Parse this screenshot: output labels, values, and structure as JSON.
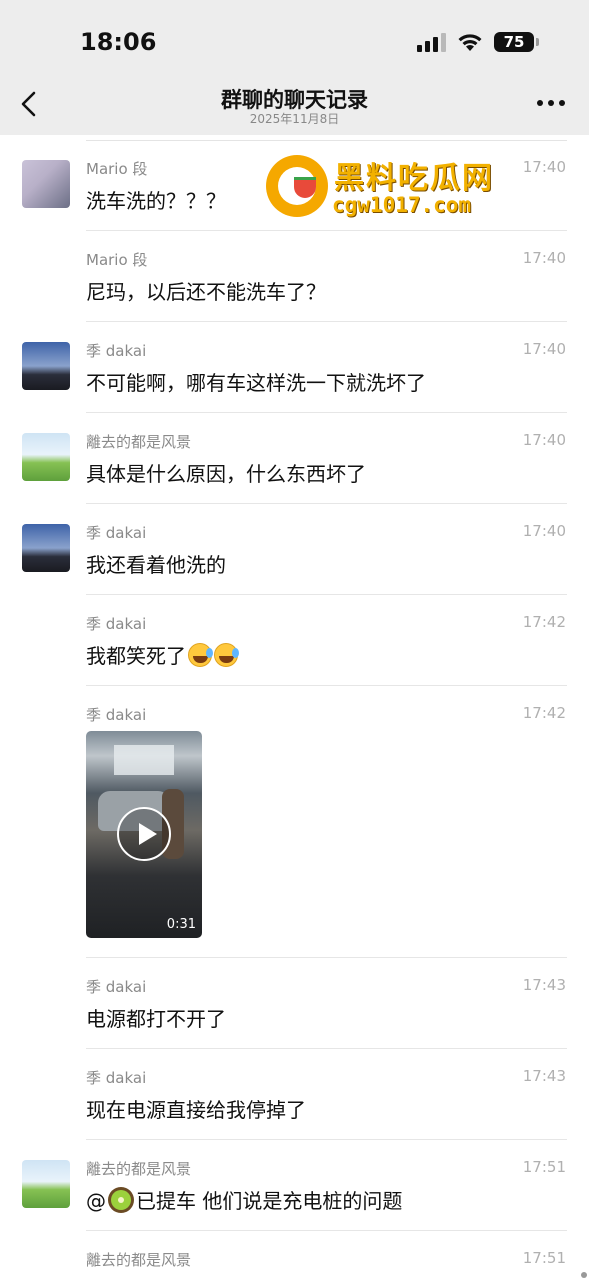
{
  "status_bar": {
    "time": "18:06",
    "battery": "75"
  },
  "nav": {
    "title": "群聊的聊天记录",
    "date": "2025年11月8日"
  },
  "watermark": {
    "title": "黑料吃瓜网",
    "url": "cgw1017.com"
  },
  "messages": [
    {
      "sender": "Mario 段",
      "time": "17:40",
      "text": "洗车洗的？？？",
      "avatar": "cat-photo"
    },
    {
      "sender": "Mario 段",
      "time": "17:40",
      "text": "尼玛，以后还不能洗车了？"
    },
    {
      "sender": "季 dakai",
      "time": "17:40",
      "text": "不可能啊，哪有车这样洗一下就洗坏了",
      "avatar": "dusk-lake"
    },
    {
      "sender": "離去的都是风景",
      "time": "17:40",
      "text": "具体是什么原因，什么东西坏了",
      "avatar": "group-on-grass"
    },
    {
      "sender": "季 dakai",
      "time": "17:40",
      "text": "我还看着他洗的",
      "avatar": "dusk-lake"
    },
    {
      "sender": "季 dakai",
      "time": "17:42",
      "text": "我都笑死了",
      "emoji": "laughing-crying-emoji"
    },
    {
      "sender": "季 dakai",
      "time": "17:42",
      "video_duration": "0:31"
    },
    {
      "sender": "季 dakai",
      "time": "17:43",
      "text": "电源都打不开了"
    },
    {
      "sender": "季 dakai",
      "time": "17:43",
      "text": "现在电源直接给我停掉了"
    },
    {
      "sender": "離去的都是风景",
      "time": "17:51",
      "text_prefix": "@",
      "text": "已提车 他们说是充电桩的问题",
      "emoji": "kiwi-emoji",
      "avatar": "group-on-grass"
    },
    {
      "sender": "離去的都是风景",
      "time": "17:51"
    }
  ],
  "icons": [
    "back-chevron-icon",
    "more-dots-icon",
    "signal-icon",
    "wifi-icon",
    "battery-icon",
    "play-icon"
  ]
}
